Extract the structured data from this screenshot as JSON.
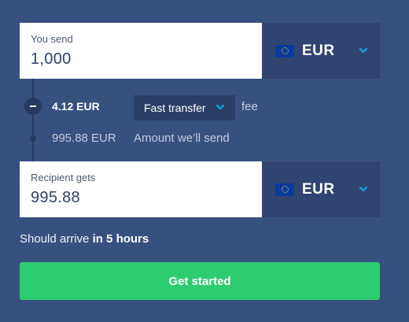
{
  "send": {
    "label": "You send",
    "amount": "1,000",
    "currency": "EUR",
    "flag_icon": "eu-flag-icon"
  },
  "fee": {
    "amount": "4.12 EUR",
    "type_selected": "Fast transfer",
    "suffix": "fee"
  },
  "conversion": {
    "amount": "995.88 EUR",
    "label": "Amount we’ll send"
  },
  "recipient": {
    "label": "Recipient gets",
    "amount": "995.88",
    "currency": "EUR",
    "flag_icon": "eu-flag-icon"
  },
  "arrival": {
    "prefix": "Should arrive",
    "time": "in 5 hours"
  },
  "cta": {
    "label": "Get started"
  },
  "colors": {
    "background": "#37517e",
    "accent": "#2ecc71",
    "chevron": "#1aa3ec"
  }
}
